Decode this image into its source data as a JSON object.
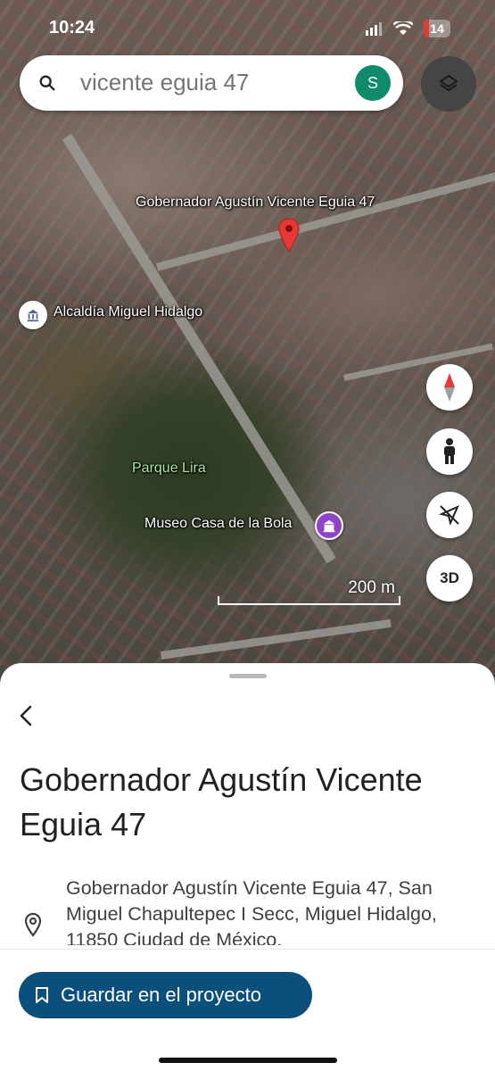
{
  "status_bar": {
    "time": "10:24",
    "battery": "14"
  },
  "search": {
    "query": "vicente eguia 47",
    "avatar_letter": "S"
  },
  "map": {
    "pin_label": "Gobernador Agustín Vicente Eguia 47",
    "labels": {
      "alcaldia": "Alcaldía Miguel Hidalgo",
      "park": "Parque Lira",
      "museum": "Museo Casa de la Bola"
    },
    "scale": "200 m",
    "btn_3d": "3D"
  },
  "place": {
    "title": "Gobernador Agustín Vicente Eguia 47",
    "address": "Gobernador Agustín Vicente Eguia 47, San Miguel Chapultepec I Secc, Miguel Hidalgo, 11850 Ciudad de México,",
    "save_label": "Guardar en el proyecto"
  },
  "icons": {
    "search": "search-icon",
    "layers": "layers-icon",
    "compass": "compass-icon",
    "pegman": "pegman-icon",
    "location_off": "location-off-icon",
    "back": "back-arrow-icon",
    "pin": "location-pin-icon",
    "bookmark": "bookmark-icon"
  },
  "colors": {
    "pin": "#e53935",
    "avatar": "#0f8a6a",
    "save_button": "#0b4f7c",
    "park_label": "#a8e6a0"
  }
}
